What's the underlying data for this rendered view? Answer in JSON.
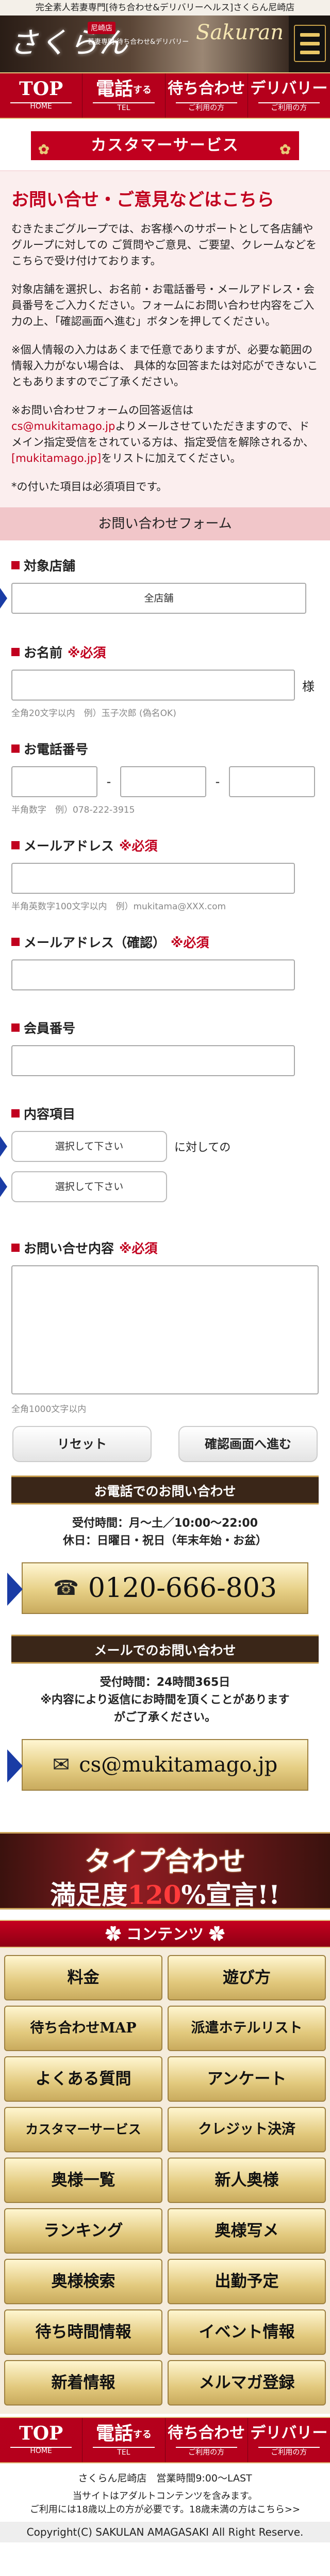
{
  "tagline": "完全素人若妻専門[待ち合わせ&デリバリーヘルス]さくらん尼崎店",
  "header": {
    "logo": "さくらん",
    "logo_tag": "尼崎店",
    "logo_sub": "若妻専門 待ち合わせ&デリバリー",
    "logo_script": "Sakuran"
  },
  "nav": [
    {
      "main": "TOP",
      "sub": "HOME"
    },
    {
      "main": "電話",
      "small": "する",
      "sub": "TEL"
    },
    {
      "main": "待ち合わせ",
      "sub": "ご利用の方"
    },
    {
      "main": "デリバリー",
      "sub": "ご利用の方"
    }
  ],
  "page_title": "カスタマーサービス",
  "intro": {
    "heading": "お問い合せ・ご意見などはこちら",
    "p1": "むきたまごグループでは、お客様へのサポートとして各店舗やグループに対しての ご質問やご意見、ご要望、クレームなどをこちらで受け付けております。",
    "p2": "対象店舗を選択し、お名前・お電話番号・メールアドレス・会員番号をご入力ください。フォームにお問い合わせ内容をご入力の上、「確認画面へ進む」ボタンを押してください。",
    "p3": "※個人情報の入力はあくまで任意でありますが、必要な範囲の情報入力がない場合は、 具体的な回答または対応ができないこともありますのでご了承ください。",
    "p4a": "※お問い合わせフォームの回答返信は",
    "p4_mail": "cs@mukitamago.jp",
    "p4b": "よりメールさせていただきますので、ドメイン指定受信をされている方は、指定受信を解除されるか、",
    "p4_domain": "[mukitamago.jp]",
    "p4c": "をリストに加えてください。",
    "p5": "*の付いた項目は必須項目です。"
  },
  "form": {
    "header": "お問い合わせフォーム",
    "store_label": "対象店舗",
    "store_value": "全店舗",
    "name_label": "お名前",
    "required": "※必須",
    "name_suffix": "様",
    "name_hint": "全角20文字以内　例）玉子次郎 (偽名OK)",
    "tel_label": "お電話番号",
    "tel_dash": "-",
    "tel_hint": "半角数字　例）078-222-3915",
    "email_label": "メールアドレス",
    "email_hint": "半角英数字100文字以内　例）mukitama@XXX.com",
    "email_confirm_label": "メールアドレス（確認）",
    "member_label": "会員番号",
    "content_label": "内容項目",
    "select1": "選択して下さい",
    "select_suffix": "に対しての",
    "select2": "選択して下さい",
    "body_label": "お問い合せ内容",
    "body_hint": "全角1000文字以内",
    "reset": "リセット",
    "confirm": "確認画面へ進む"
  },
  "tel_contact": {
    "bar": "お電話でのお問い合わせ",
    "hours1": "受付時間：月〜土／10:00〜22:00",
    "hours2": "休日：日曜日・祝日（年末年始・お盆）",
    "number": "0120-666-803",
    "icon": "phone-icon"
  },
  "mail_contact": {
    "bar": "メールでのお問い合わせ",
    "hours1": "受付時間：24時間365日",
    "hours2": "※内容により返信にお時間を頂くことがありますがご了承ください。",
    "address": "cs@mukitamago.jp",
    "icon": "mail-icon"
  },
  "banner": {
    "line1": "タイプ合わせ",
    "line2a": "満足度",
    "line2b": "120",
    "line2c": "%宣言!!"
  },
  "contents": {
    "title": "コンテンツ",
    "items": [
      "料金",
      "遊び方",
      "待ち合わせMAP",
      "派遣ホテルリスト",
      "よくある質問",
      "アンケート",
      "カスタマーサービス",
      "クレジット決済",
      "奥様一覧",
      "新人奥様",
      "ランキング",
      "奥様写メ",
      "奥様検索",
      "出勤予定",
      "待ち時間情報",
      "イベント情報",
      "新着情報",
      "メルマガ登録"
    ]
  },
  "footer": {
    "shop": "さくらん尼崎店　営業時間9:00〜LAST",
    "note1": "当サイトはアダルトコンテンツを含みます。",
    "note2": "ご利用には18歳以上の方が必要です。18歳未満の方はこちら>>",
    "copyright": "Copyright(C) SAKULAN AMAGASAKI All Right Reserve."
  }
}
